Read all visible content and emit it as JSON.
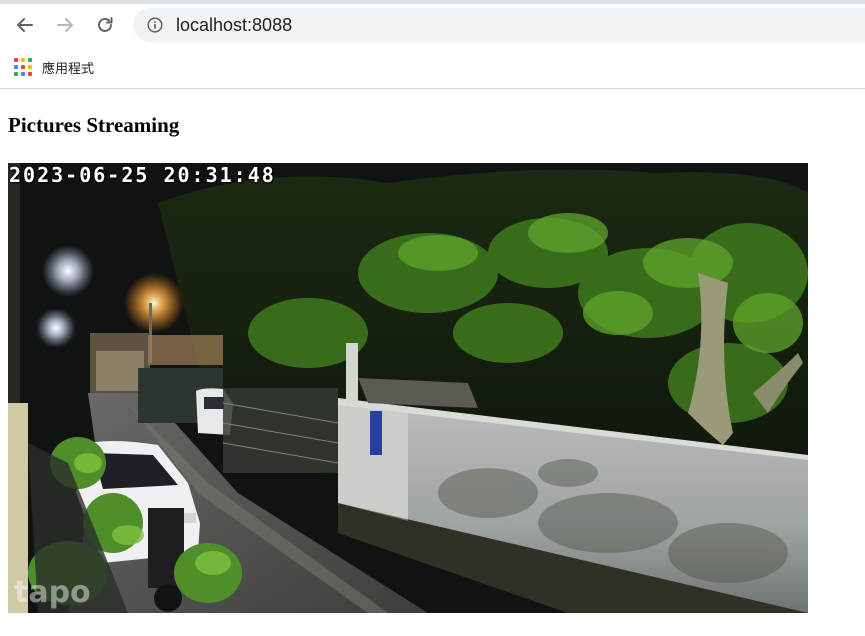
{
  "browser": {
    "url": "localhost:8088",
    "bookmarks": [
      {
        "label": "應用程式",
        "icon": "apps-grid-icon"
      }
    ],
    "icons": {
      "back": "back-arrow-icon",
      "forward": "forward-arrow-icon",
      "reload": "reload-icon",
      "site_info": "info-icon"
    }
  },
  "page": {
    "heading": "Pictures Streaming",
    "stream": {
      "timestamp": "2023-06-25 20:31:48",
      "watermark": "tapo"
    }
  },
  "colors": {
    "apps_grid": [
      "#ea4335",
      "#fbbc04",
      "#34a853",
      "#4285f4",
      "#ea4335",
      "#fbbc04",
      "#34a853",
      "#4285f4",
      "#ea4335"
    ]
  }
}
